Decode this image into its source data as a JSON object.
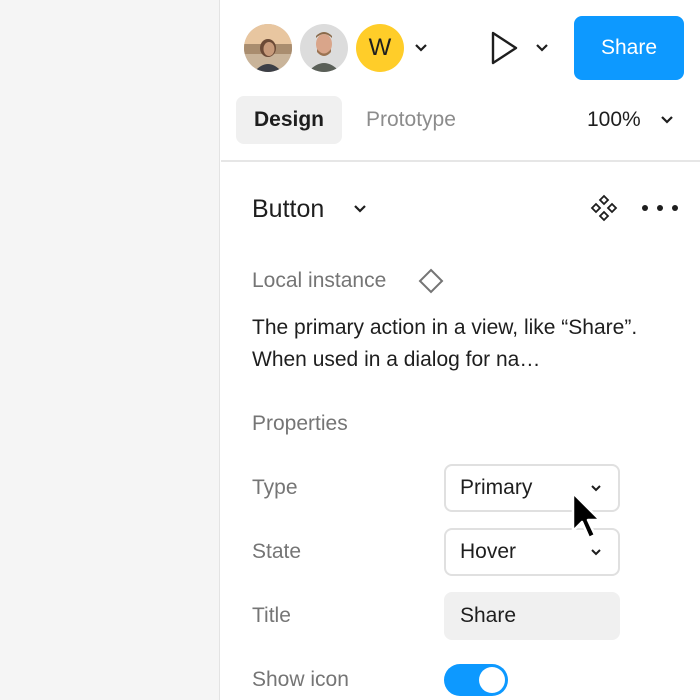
{
  "header": {
    "avatars": [
      {
        "name": "avatar-1"
      },
      {
        "name": "avatar-2"
      },
      {
        "initial": "W",
        "color": "#ffcd29"
      }
    ],
    "share_label": "Share",
    "accent_color": "#0d99ff"
  },
  "tabs": {
    "design": "Design",
    "prototype": "Prototype",
    "zoom": "100%"
  },
  "component": {
    "name": "Button",
    "instance_label": "Local instance",
    "description": "The primary action in a view, like “Share”. When used in a dialog for na…"
  },
  "properties": {
    "title": "Properties",
    "type": {
      "label": "Type",
      "value": "Primary"
    },
    "state": {
      "label": "State",
      "value": "Hover"
    },
    "title_prop": {
      "label": "Title",
      "value": "Share"
    },
    "show_icon": {
      "label": "Show icon",
      "value": true
    }
  },
  "icons": [
    "chevron-down-icon",
    "play-icon",
    "component-icon",
    "more-icon",
    "instance-diamond-icon",
    "cursor-icon"
  ]
}
